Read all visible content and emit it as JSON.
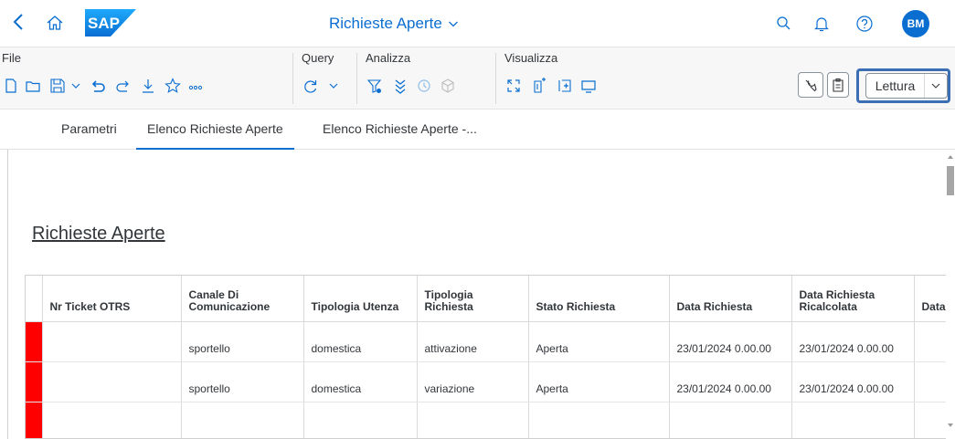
{
  "shell": {
    "app_title": "Richieste Aperte",
    "avatar_initials": "BM",
    "accent": "#0a6ed1"
  },
  "toolbar": {
    "groups": {
      "file": "File",
      "query": "Query",
      "analizza": "Analizza",
      "visualizza": "Visualizza"
    },
    "mode_label": "Lettura"
  },
  "tabs": [
    {
      "label": "Parametri",
      "active": false
    },
    {
      "label": "Elenco Richieste Aperte",
      "active": true
    },
    {
      "label": "Elenco Richieste Aperte -...",
      "active": false
    }
  ],
  "report": {
    "title": "Richieste Aperte",
    "columns": [
      "",
      "Nr Ticket OTRS",
      "Canale Di Comunicazione",
      "Tipologia Utenza",
      "Tipologia Richiesta",
      "Stato Richiesta",
      "Data Richiesta",
      "Data Richiesta Ricalcolata",
      "Data"
    ],
    "rows": [
      [
        "",
        "",
        "sportello",
        "domestica",
        "attivazione",
        "Aperta",
        "23/01/2024 0.00.00",
        "23/01/2024 0.00.00",
        ""
      ],
      [
        "",
        "",
        "sportello",
        "domestica",
        "variazione",
        "Aperta",
        "23/01/2024 0.00.00",
        "23/01/2024 0.00.00",
        ""
      ],
      [
        "",
        "",
        "",
        "",
        "",
        "",
        "",
        "",
        ""
      ]
    ],
    "indicator_color": "#ff0000"
  }
}
